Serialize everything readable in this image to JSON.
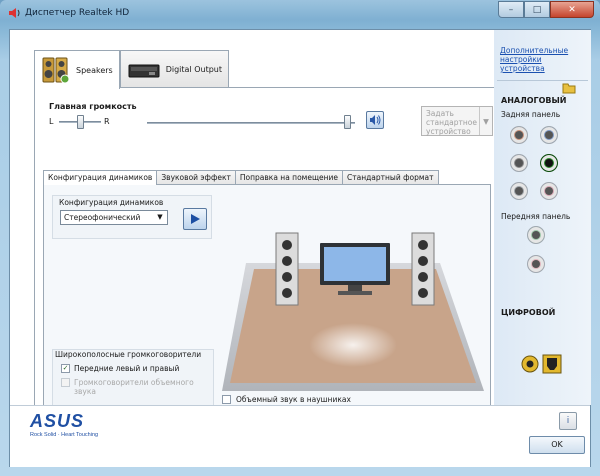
{
  "window": {
    "title": "Диспетчер Realtek HD",
    "minimize": "–",
    "maximize": "□",
    "close": "✕"
  },
  "device_tabs": [
    {
      "label": "Speakers",
      "active": true
    },
    {
      "label": "Digital Output",
      "active": false
    }
  ],
  "volume": {
    "label": "Главная громкость",
    "left": "L",
    "right": "R",
    "balance_level": 0.5,
    "volume_level": 1.0
  },
  "default_device": {
    "label": "Задать стандартное устройство",
    "enabled": false
  },
  "sub_tabs": [
    {
      "label": "Конфигурация динамиков",
      "active": true
    },
    {
      "label": "Звуковой эффект",
      "active": false
    },
    {
      "label": "Поправка на помещение",
      "active": false
    },
    {
      "label": "Стандартный формат",
      "active": false
    }
  ],
  "speaker_config": {
    "label": "Конфигурация динамиков",
    "selected": "Стереофонический"
  },
  "broadband": {
    "title": "Широкополосные громкоговорители",
    "front": {
      "label": "Передние левый и правый",
      "checked": true,
      "enabled": true
    },
    "surround": {
      "label": "Громкоговорители объемного звука",
      "checked": false,
      "enabled": false
    }
  },
  "headphone_surround": {
    "label": "Объемный звук в наушниках",
    "checked": false
  },
  "right_panel": {
    "advanced_link": "Дополнительные настройки устройства",
    "analog_title": "АНАЛОГОВЫЙ",
    "back_panel": "Задняя панель",
    "front_panel": "Передняя панель",
    "digital_title": "ЦИФРОВОЙ",
    "colors": {
      "orange": "#c8917a",
      "blue": "#7d97c4",
      "gray": "#8c8c8c",
      "green": "#2e8a2e",
      "light_gray": "#9ea3a8",
      "pink": "#d8a6b4",
      "light_green": "#9ec7a8",
      "light_pink": "#e0b4bc"
    }
  },
  "brand": {
    "name": "ASUS",
    "tagline": "Rock Solid · Heart Touching"
  },
  "buttons": {
    "ok": "OK",
    "info": "i"
  },
  "colors": {
    "accent": "#1a50b0",
    "frame": "#86b6d6"
  }
}
